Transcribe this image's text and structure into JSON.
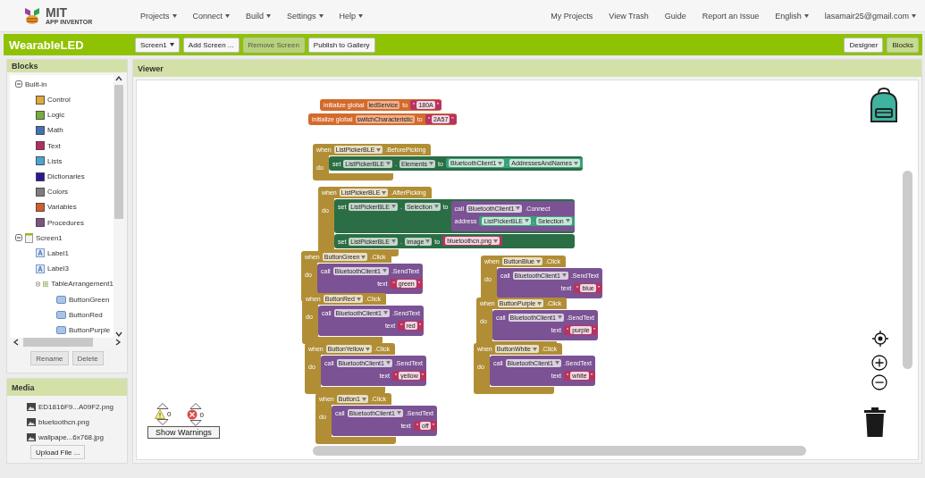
{
  "header": {
    "logo": {
      "title": "MIT",
      "subtitle": "APP INVENTOR"
    },
    "menus": [
      "Projects",
      "Connect",
      "Build",
      "Settings",
      "Help"
    ],
    "links": [
      "My Projects",
      "View Trash",
      "Guide",
      "Report an Issue"
    ],
    "language": "English",
    "account": "lasamair25@gmail.com"
  },
  "project_bar": {
    "title": "WearableLED",
    "screen": "Screen1",
    "buttons": [
      {
        "label": "Add Screen ...",
        "disabled": false
      },
      {
        "label": "Remove Screen",
        "disabled": true
      },
      {
        "label": "Publish to Gallery",
        "disabled": false
      }
    ],
    "views": [
      {
        "label": "Designer",
        "selected": false
      },
      {
        "label": "Blocks",
        "selected": true
      }
    ]
  },
  "blocks_panel": {
    "title": "Blocks",
    "tree": [
      {
        "label": "Built-in",
        "kind": "folder",
        "expanded": true,
        "children": [
          {
            "label": "Control",
            "kind": "category",
            "color": "#e0a93a"
          },
          {
            "label": "Logic",
            "kind": "category",
            "color": "#77ab41"
          },
          {
            "label": "Math",
            "kind": "category",
            "color": "#3f71b5"
          },
          {
            "label": "Text",
            "kind": "category",
            "color": "#b32d5e"
          },
          {
            "label": "Lists",
            "kind": "category",
            "color": "#49a6d4"
          },
          {
            "label": "Dictionaries",
            "kind": "category",
            "color": "#2d1799"
          },
          {
            "label": "Colors",
            "kind": "category",
            "color": "#7d7d7d"
          },
          {
            "label": "Variables",
            "kind": "category",
            "color": "#d05f2d"
          },
          {
            "label": "Procedures",
            "kind": "category",
            "color": "#7c5385"
          }
        ]
      },
      {
        "label": "Screen1",
        "kind": "screen",
        "expanded": true,
        "children": [
          {
            "label": "Label1",
            "kind": "label"
          },
          {
            "label": "Label3",
            "kind": "label"
          },
          {
            "label": "TableArrangement1",
            "kind": "arrangement",
            "expanded": true,
            "children": [
              {
                "label": "ButtonGreen",
                "kind": "button"
              },
              {
                "label": "ButtonRed",
                "kind": "button"
              },
              {
                "label": "ButtonPurple",
                "kind": "button"
              }
            ]
          }
        ]
      }
    ],
    "buttons": [
      "Rename",
      "Delete"
    ]
  },
  "media": {
    "title": "Media",
    "files": [
      "ED1816F9...A09F2.png",
      "bluetoothcn.png",
      "wallpape...6x768.jpg"
    ],
    "upload": "Upload File ..."
  },
  "viewer": {
    "title": "Viewer",
    "blocks": [
      {
        "kind": "global",
        "keyword": "initialize global",
        "name": "ledService",
        "to": "to",
        "value": {
          "kind": "string",
          "open": "“",
          "text": "180A",
          "close": "”"
        }
      },
      {
        "kind": "global",
        "keyword": "initialize global",
        "name": "switchCharacteristic",
        "to": "to",
        "value": {
          "kind": "string",
          "open": "“",
          "text": "2A57",
          "close": "”"
        }
      },
      {
        "kind": "event",
        "when": "when",
        "component": "ListPickerBLE",
        "event": ".BeforePicking",
        "do": "do",
        "statements": [
          {
            "kind": "set",
            "keyword": "set",
            "component": "ListPickerBLE",
            "separator": ".",
            "property": "Elements",
            "to": "to",
            "value": {
              "kind": "getter",
              "component": "BluetoothClient1",
              "separator": ".",
              "property": "AddressesAndNames"
            }
          }
        ]
      },
      {
        "kind": "event",
        "when": "when",
        "component": "ListPickerBLE",
        "event": ".AfterPicking",
        "do": "do",
        "statements": [
          {
            "kind": "set",
            "keyword": "set",
            "component": "ListPickerBLE",
            "separator": ".",
            "property": "Selection",
            "to": "to",
            "value": {
              "kind": "call",
              "keyword": "call",
              "component": "BluetoothClient1",
              "method": ".Connect",
              "param": "address",
              "value": {
                "kind": "getter",
                "component": "ListPickerBLE",
                "separator": ".",
                "property": "Selection"
              }
            }
          },
          {
            "kind": "set",
            "keyword": "set",
            "component": "ListPickerBLE",
            "separator": ".",
            "property": "Image",
            "to": "to",
            "value": {
              "kind": "asset",
              "text": "bluetoothcn.png"
            }
          }
        ]
      },
      {
        "kind": "event",
        "when": "when",
        "component": "ButtonGreen",
        "event": ".Click",
        "do": "do",
        "statements": [
          {
            "kind": "call",
            "keyword": "call",
            "component": "BluetoothClient1",
            "method": ".SendText",
            "param": "text",
            "value": {
              "kind": "string",
              "open": "“",
              "text": "green",
              "close": "”"
            }
          }
        ]
      },
      {
        "kind": "event",
        "when": "when",
        "component": "ButtonBlue",
        "event": ".Click",
        "do": "do",
        "statements": [
          {
            "kind": "call",
            "keyword": "call",
            "component": "BluetoothClient1",
            "method": ".SendText",
            "param": "text",
            "value": {
              "kind": "string",
              "open": "“",
              "text": "blue",
              "close": "”"
            }
          }
        ]
      },
      {
        "kind": "event",
        "when": "when",
        "component": "ButtonRed",
        "event": ".Click",
        "do": "do",
        "statements": [
          {
            "kind": "call",
            "keyword": "call",
            "component": "BluetoothClient1",
            "method": ".SendText",
            "param": "text",
            "value": {
              "kind": "string",
              "open": "“",
              "text": "red",
              "close": "”"
            }
          }
        ]
      },
      {
        "kind": "event",
        "when": "when",
        "component": "ButtonPurple",
        "event": ".Click",
        "do": "do",
        "statements": [
          {
            "kind": "call",
            "keyword": "call",
            "component": "BluetoothClient1",
            "method": ".SendText",
            "param": "text",
            "value": {
              "kind": "string",
              "open": "“",
              "text": "purple",
              "close": "”"
            }
          }
        ]
      },
      {
        "kind": "event",
        "when": "when",
        "component": "ButtonYellow",
        "event": ".Click",
        "do": "do",
        "statements": [
          {
            "kind": "call",
            "keyword": "call",
            "component": "BluetoothClient1",
            "method": ".SendText",
            "param": "text",
            "value": {
              "kind": "string",
              "open": "“",
              "text": "yellow",
              "close": "”"
            }
          }
        ]
      },
      {
        "kind": "event",
        "when": "when",
        "component": "ButtonWhite",
        "event": ".Click",
        "do": "do",
        "statements": [
          {
            "kind": "call",
            "keyword": "call",
            "component": "BluetoothClient1",
            "method": ".SendText",
            "param": "text",
            "value": {
              "kind": "string",
              "open": "“",
              "text": "white",
              "close": "”"
            }
          }
        ]
      },
      {
        "kind": "event",
        "when": "when",
        "component": "Button1",
        "event": ".Click",
        "do": "do",
        "statements": [
          {
            "kind": "call",
            "keyword": "call",
            "component": "BluetoothClient1",
            "method": ".SendText",
            "param": "text",
            "value": {
              "kind": "string",
              "open": "“",
              "text": "off",
              "close": "”"
            }
          }
        ]
      }
    ],
    "warnings": {
      "warning_count": "0",
      "error_count": "0",
      "button": "Show Warnings"
    }
  }
}
